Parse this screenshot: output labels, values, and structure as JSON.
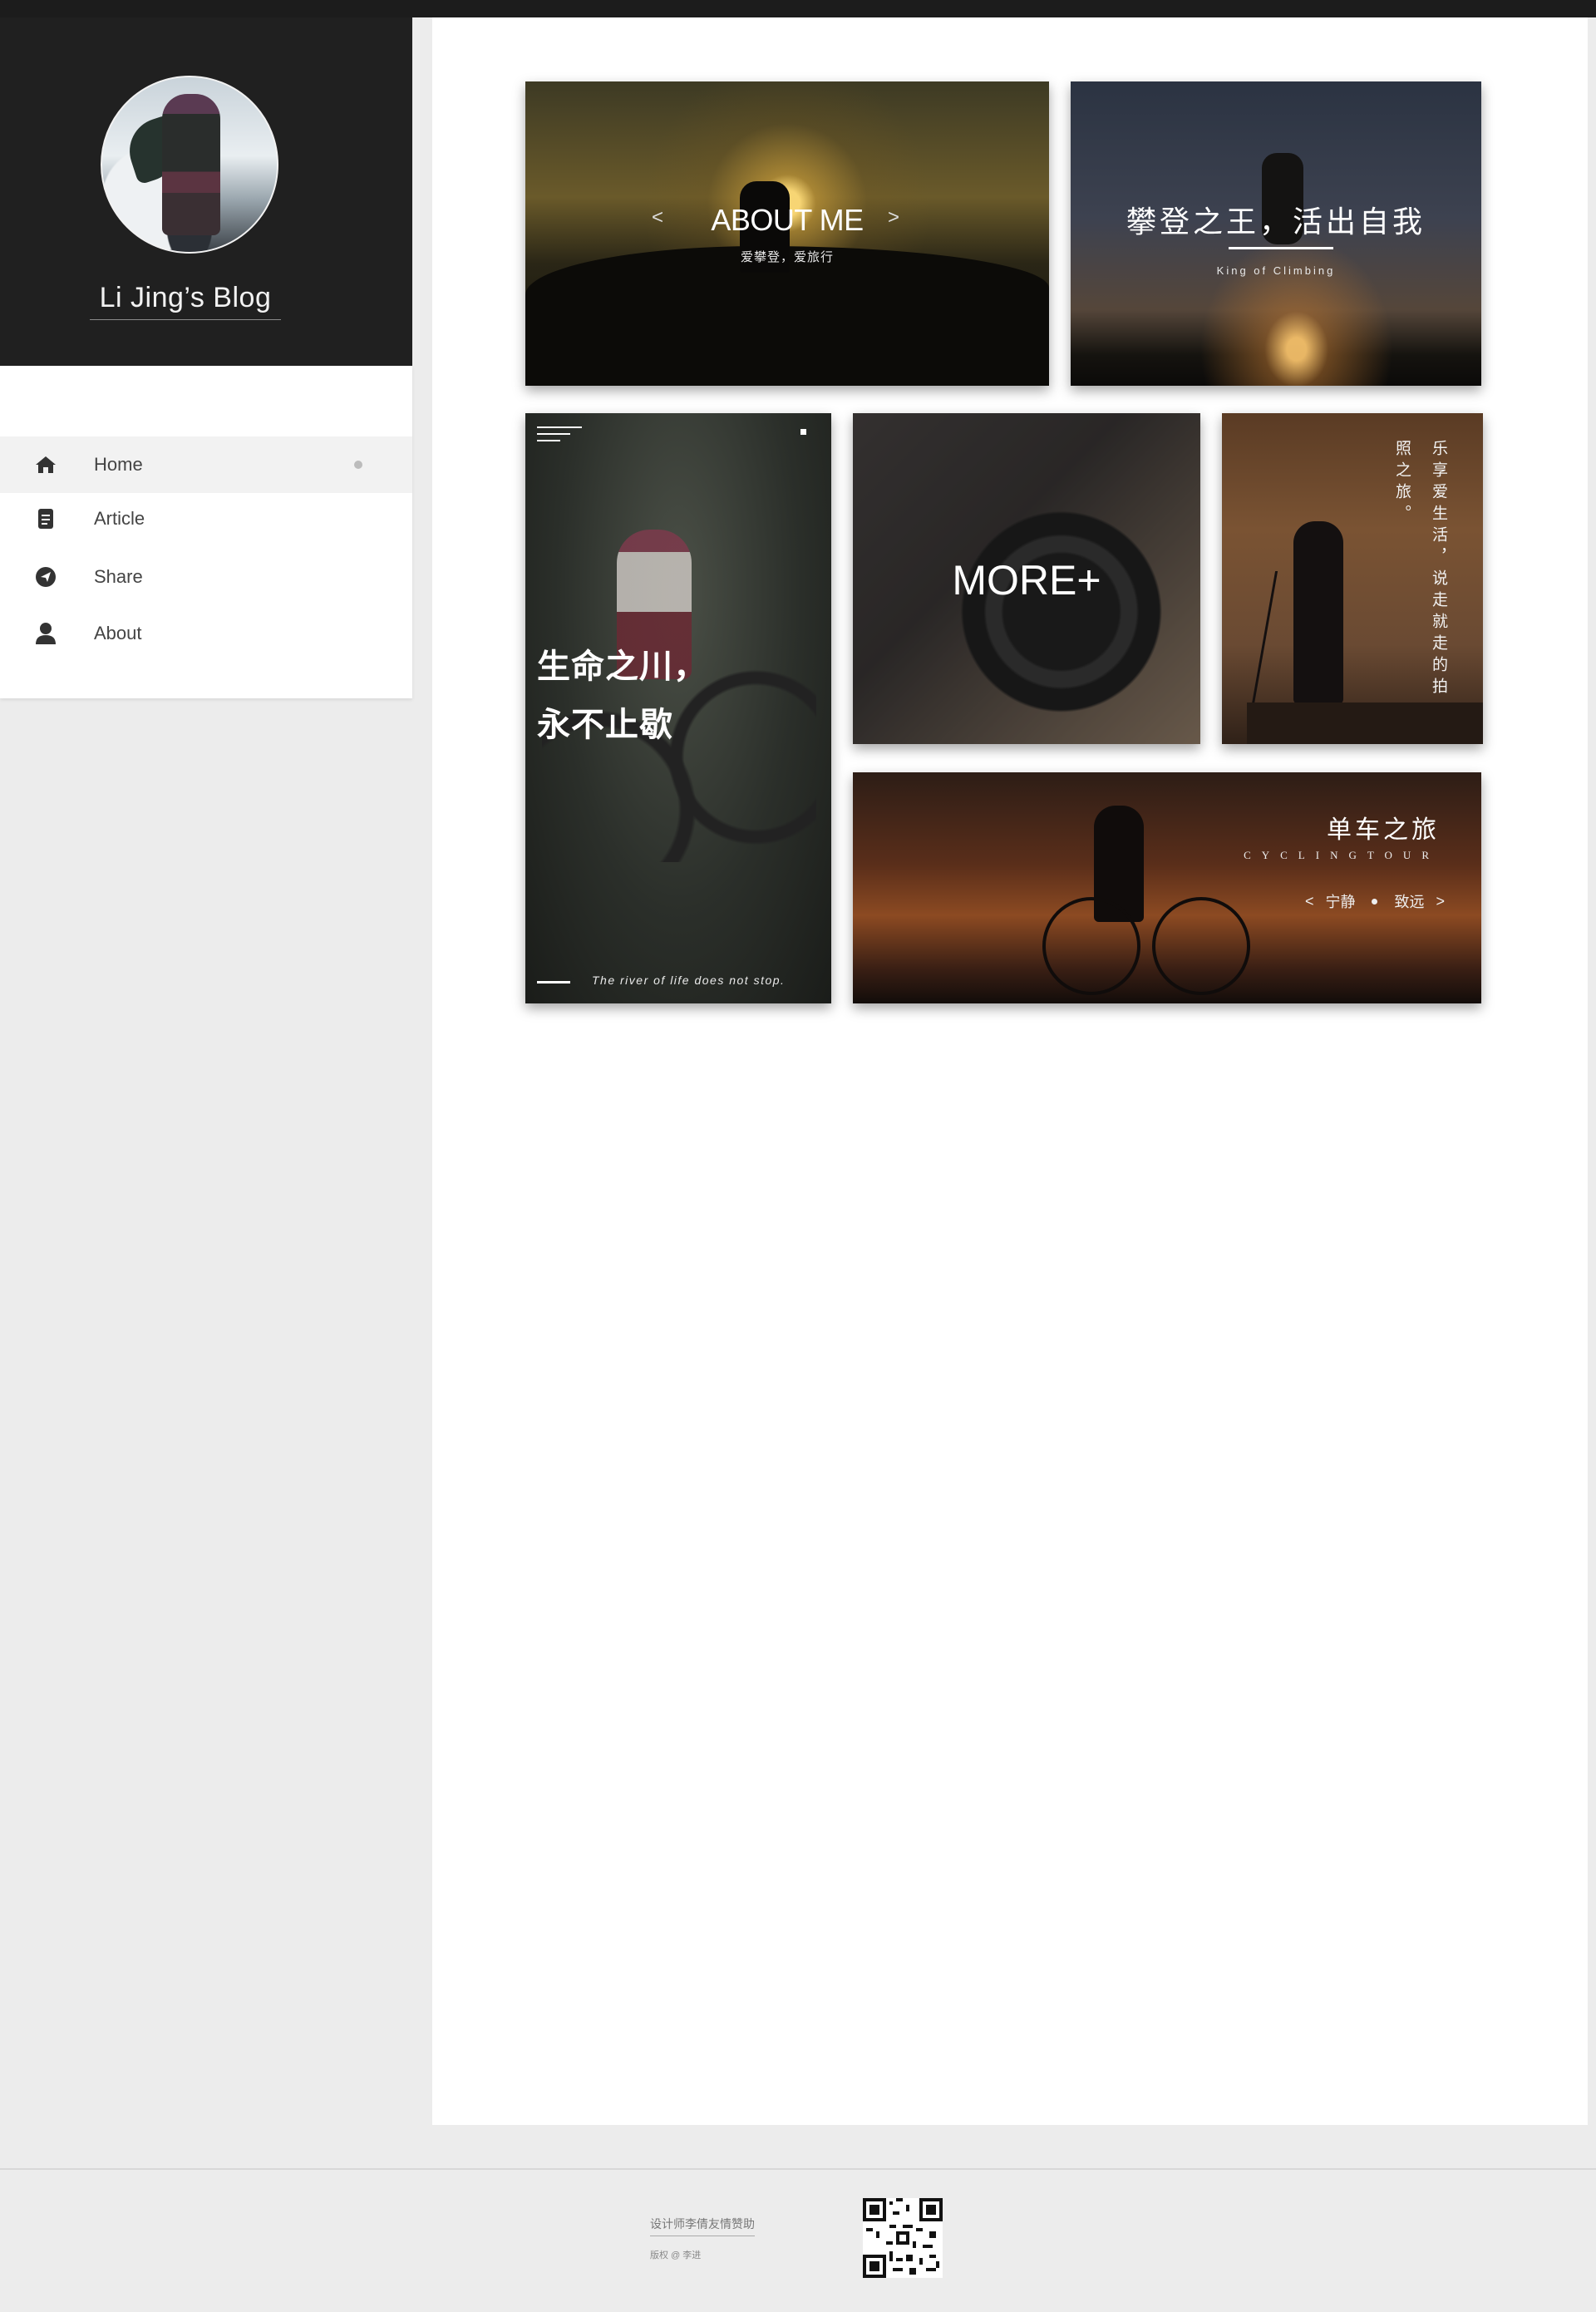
{
  "sidebar": {
    "blog_title": "Li Jing’s Blog",
    "nav": [
      {
        "label": "Home",
        "icon": "home-icon",
        "active": true
      },
      {
        "label": "Article",
        "icon": "article-icon",
        "active": false
      },
      {
        "label": "Share",
        "icon": "share-icon",
        "active": false
      },
      {
        "label": "About",
        "icon": "user-icon",
        "active": false
      }
    ]
  },
  "cards": {
    "about": {
      "title": "ABOUT ME",
      "subtitle": "爱攀登，爱旅行",
      "prev": "<",
      "next": ">"
    },
    "climbing": {
      "title": "攀登之王，活出自我",
      "subtitle": "King of Climbing"
    },
    "moto": {
      "title": "生命之川，\n永不止歇",
      "subtitle": "The river of life does not stop."
    },
    "more": {
      "title": "MORE+"
    },
    "photo": {
      "text": "乐享爱生活，说走就走的拍照之旅。"
    },
    "cycling": {
      "title": "单车之旅",
      "subtitle": "CYCLINGTOUR",
      "prev": "<",
      "left_word": "宁静",
      "right_word": "致远",
      "next": ">"
    }
  },
  "footer": {
    "sponsor": "设计师李倩友情赞助",
    "copyright": "版权 @ 李进"
  },
  "colors": {
    "sidebar_dark": "#202020",
    "page_bg": "#ececec",
    "active_item": "#f2f2f2"
  }
}
